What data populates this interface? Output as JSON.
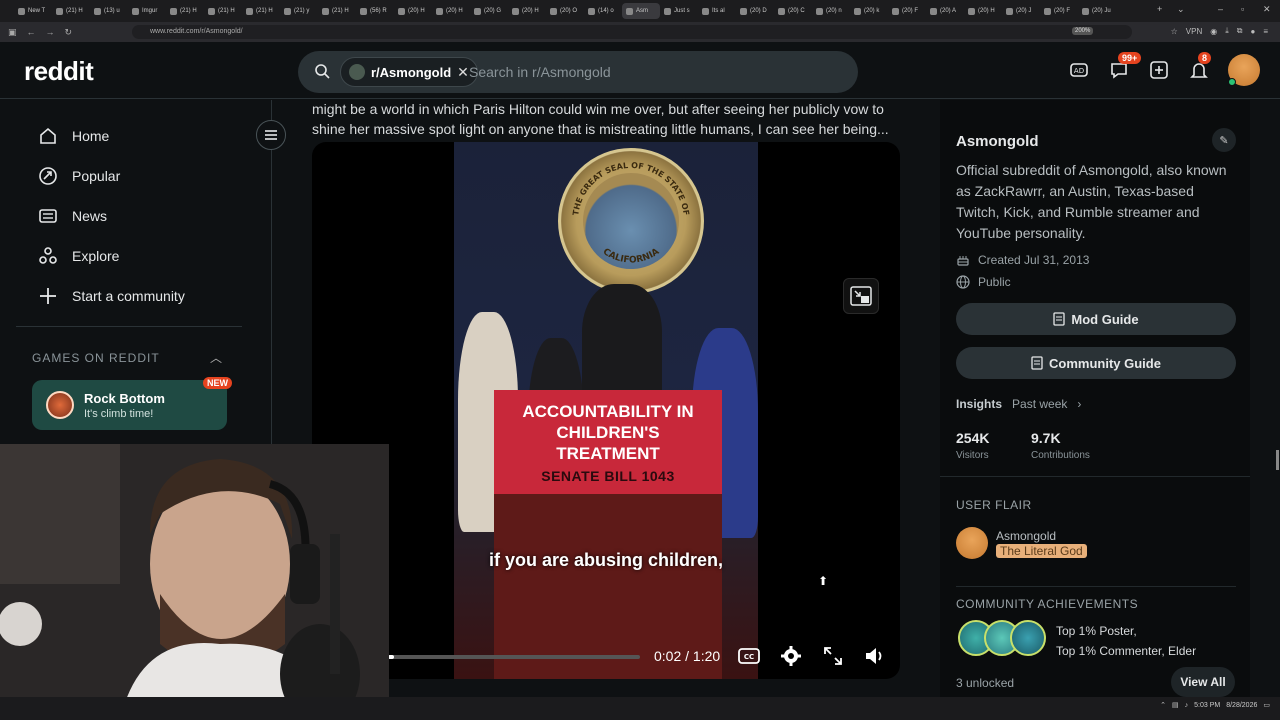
{
  "browser": {
    "tabs": [
      "New T",
      "(21) H",
      "(13) u",
      "Imgur",
      "(21) H",
      "(21) H",
      "(21) H",
      "(21) y",
      "(21) H",
      "(56) R",
      "(20) H",
      "(20) H",
      "(20) G",
      "(20) H",
      "(20) O",
      "(14) o",
      "Asm",
      "Just s",
      "Its al",
      "(20) D",
      "(20) C",
      "(20) n",
      "(20) k",
      "(20) F",
      "(20) A",
      "(20) H",
      "(20) J",
      "(20) F",
      "(20) Ju"
    ],
    "url": "www.reddit.com/r/Asmongold/",
    "zoom": "200%",
    "vpn_label": "VPN"
  },
  "header": {
    "logo": "reddit",
    "search_chip": "r/Asmongold",
    "search_placeholder": "Search in r/Asmongold",
    "chat_badge": "99+",
    "notif_badge": "8"
  },
  "sidebar": {
    "items": [
      {
        "label": "Home",
        "icon": "home-icon"
      },
      {
        "label": "Popular",
        "icon": "popular-icon"
      },
      {
        "label": "News",
        "icon": "news-icon"
      },
      {
        "label": "Explore",
        "icon": "explore-icon"
      },
      {
        "label": "Start a community",
        "icon": "plus-icon"
      }
    ],
    "games_title": "GAMES ON REDDIT",
    "game": {
      "name": "Rock Bottom",
      "sub": "It's climb time!",
      "badge": "NEW"
    }
  },
  "post": {
    "text": "might be a world in which Paris Hilton could win me over, but after seeing her publicly vow to shine her massive spot light on anyone that is mistreating little humans, I can see her being...",
    "sign_line1": "ACCOUNTABILITY IN",
    "sign_line2": "CHILDREN'S",
    "sign_line3": "TREATMENT",
    "sign_sub": "SENATE BILL 1043",
    "seal_top": "THE GREAT SEAL OF THE STATE OF",
    "seal_bottom": "CALIFORNIA",
    "caption": "if you are abusing children,",
    "time": "0:02 / 1:20",
    "progress": 0.025
  },
  "rightbar": {
    "title": "Asmongold",
    "description": "Official subreddit of Asmongold, also known as ZackRawrr, an Austin, Texas-based Twitch, Kick, and Rumble streamer and YouTube personality.",
    "created": "Created Jul 31, 2013",
    "visibility": "Public",
    "mod_guide": "Mod Guide",
    "community_guide": "Community Guide",
    "insights_label": "Insights",
    "insights_period": "Past week",
    "visitors_value": "254K",
    "visitors_label": "Visitors",
    "contrib_value": "9.7K",
    "contrib_label": "Contributions",
    "flair_title": "USER FLAIR",
    "flair_user": "Asmongold",
    "flair_tag": "The Literal God",
    "ach_title": "COMMUNITY ACHIEVEMENTS",
    "ach_line1": "Top 1% Poster,",
    "ach_line2": "Top 1% Commenter, Elder",
    "unlocked": "3 unlocked",
    "view_all": "View All"
  },
  "taskbar": {
    "time": "5:03 PM",
    "date": "8/28/2026"
  },
  "colors": {
    "accent": "#e5431f",
    "game_card": "#1f4a43",
    "sign_red": "#c8283a"
  }
}
